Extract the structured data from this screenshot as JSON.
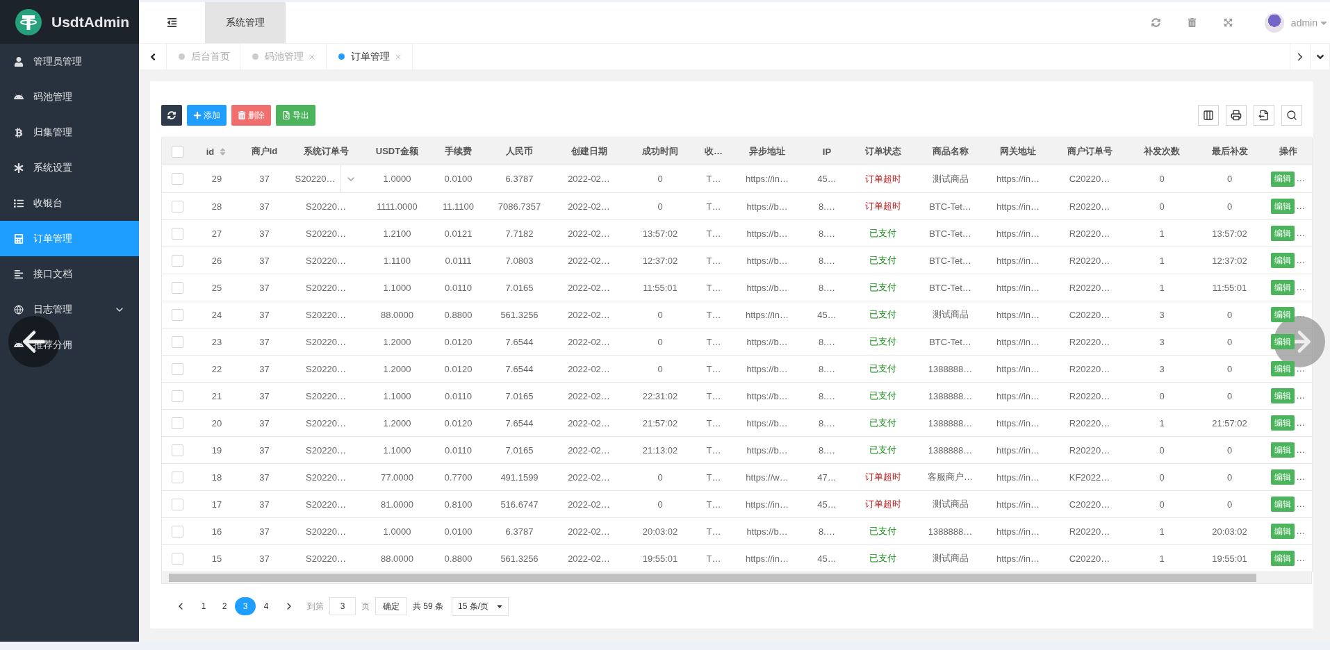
{
  "logo": {
    "title": "UsdtAdmin"
  },
  "sidebar": {
    "items": [
      {
        "label": "管理员管理",
        "selected": false,
        "expandable": false
      },
      {
        "label": "码池管理",
        "selected": false,
        "expandable": false
      },
      {
        "label": "归集管理",
        "selected": false,
        "expandable": false
      },
      {
        "label": "系统设置",
        "selected": false,
        "expandable": false
      },
      {
        "label": "收银台",
        "selected": false,
        "expandable": false
      },
      {
        "label": "订单管理",
        "selected": true,
        "expandable": false
      },
      {
        "label": "接口文档",
        "selected": false,
        "expandable": false
      },
      {
        "label": "日志管理",
        "selected": false,
        "expandable": true
      },
      {
        "label": "推荐分佣",
        "selected": false,
        "expandable": false
      }
    ]
  },
  "header": {
    "nav": [
      {
        "label": "系统管理",
        "selected": true
      }
    ],
    "user": "admin"
  },
  "page_tabs": [
    {
      "label": "后台首页",
      "selected": false,
      "closable": false
    },
    {
      "label": "码池管理",
      "selected": false,
      "closable": true
    },
    {
      "label": "订单管理",
      "selected": true,
      "closable": true
    }
  ],
  "toolbar": {
    "buttons": [
      {
        "kind": "refresh"
      },
      {
        "kind": "add",
        "label": "添加"
      },
      {
        "kind": "delete",
        "label": "删除"
      },
      {
        "kind": "export",
        "label": "导出"
      }
    ]
  },
  "table": {
    "header_checked": false,
    "columns": [
      {
        "label": "id",
        "sortable": true
      },
      {
        "label": "商户id",
        "sortable": false
      },
      {
        "label": "系统订单号",
        "sortable": false
      },
      {
        "label": "USDT金额",
        "sortable": false
      },
      {
        "label": "手续费",
        "sortable": false
      },
      {
        "label": "人民币",
        "sortable": false
      },
      {
        "label": "创建日期",
        "sortable": false
      },
      {
        "label": "成功时间",
        "sortable": false
      },
      {
        "label": "收…",
        "sortable": false
      },
      {
        "label": "异步地址",
        "sortable": false
      },
      {
        "label": "IP",
        "sortable": false
      },
      {
        "label": "订单状态",
        "sortable": false
      },
      {
        "label": "商品名称",
        "sortable": false
      },
      {
        "label": "网关地址",
        "sortable": false
      },
      {
        "label": "商户订单号",
        "sortable": false
      },
      {
        "label": "补发次数",
        "sortable": false
      },
      {
        "label": "最后补发",
        "sortable": false
      },
      {
        "label": "操作",
        "sortable": false
      }
    ],
    "rows": [
      {
        "checked": false,
        "tip_open": true,
        "cells": [
          "29",
          "37",
          "S20220…",
          "1.0000",
          "0.0100",
          "6.3787",
          "2022-02…",
          "0",
          "T…",
          "https://in…",
          "45…",
          {
            "text": "订单超时",
            "kind": "timeout"
          },
          "测试商品",
          "https://in…",
          "C20220…",
          "0",
          "0"
        ],
        "action": "编辑",
        "action_more": "…"
      },
      {
        "checked": false,
        "tip_open": false,
        "cells": [
          "28",
          "37",
          "S20220…",
          "1111.0000",
          "11.1100",
          "7086.7357",
          "2022-02…",
          "0",
          "T…",
          "https://b…",
          "8.…",
          {
            "text": "订单超时",
            "kind": "timeout"
          },
          "BTC-Tet…",
          "https://in…",
          "R20220…",
          "0",
          "0"
        ],
        "action": "编辑",
        "action_more": "…"
      },
      {
        "checked": false,
        "tip_open": false,
        "cells": [
          "27",
          "37",
          "S20220…",
          "1.2100",
          "0.0121",
          "7.7182",
          "2022-02…",
          "13:57:02",
          "T…",
          "https://b…",
          "8.…",
          {
            "text": "已支付",
            "kind": "paid"
          },
          "BTC-Tet…",
          "https://in…",
          "R20220…",
          "1",
          "13:57:02"
        ],
        "action": "编辑",
        "action_more": "…"
      },
      {
        "checked": false,
        "tip_open": false,
        "cells": [
          "26",
          "37",
          "S20220…",
          "1.1100",
          "0.0111",
          "7.0803",
          "2022-02…",
          "12:37:02",
          "T…",
          "https://b…",
          "8.…",
          {
            "text": "已支付",
            "kind": "paid"
          },
          "BTC-Tet…",
          "https://in…",
          "R20220…",
          "1",
          "12:37:02"
        ],
        "action": "编辑",
        "action_more": "…"
      },
      {
        "checked": false,
        "tip_open": false,
        "cells": [
          "25",
          "37",
          "S20220…",
          "1.1000",
          "0.0110",
          "7.0165",
          "2022-02…",
          "11:55:01",
          "T…",
          "https://b…",
          "8.…",
          {
            "text": "已支付",
            "kind": "paid"
          },
          "BTC-Tet…",
          "https://in…",
          "R20220…",
          "1",
          "11:55:01"
        ],
        "action": "编辑",
        "action_more": "…"
      },
      {
        "checked": false,
        "tip_open": false,
        "cells": [
          "24",
          "37",
          "S20220…",
          "88.0000",
          "0.8800",
          "561.3256",
          "2022-02…",
          "0",
          "T…",
          "https://in…",
          "45…",
          {
            "text": "已支付",
            "kind": "paid"
          },
          "测试商品",
          "https://in…",
          "C20220…",
          "3",
          "0"
        ],
        "action": "编辑",
        "action_more": "…"
      },
      {
        "checked": false,
        "tip_open": false,
        "cells": [
          "23",
          "37",
          "S20220…",
          "1.2000",
          "0.0120",
          "7.6544",
          "2022-02…",
          "0",
          "T…",
          "https://b…",
          "8.…",
          {
            "text": "已支付",
            "kind": "paid"
          },
          "BTC-Tet…",
          "https://in…",
          "R20220…",
          "3",
          "0"
        ],
        "action": "编辑",
        "action_more": "…"
      },
      {
        "checked": false,
        "tip_open": false,
        "cells": [
          "22",
          "37",
          "S20220…",
          "1.2000",
          "0.0120",
          "7.6544",
          "2022-02…",
          "0",
          "T…",
          "https://b…",
          "8.…",
          {
            "text": "已支付",
            "kind": "paid"
          },
          "1388888…",
          "https://in…",
          "R20220…",
          "3",
          "0"
        ],
        "action": "编辑",
        "action_more": "…"
      },
      {
        "checked": false,
        "tip_open": false,
        "cells": [
          "21",
          "37",
          "S20220…",
          "1.1000",
          "0.0110",
          "7.0165",
          "2022-02…",
          "22:31:02",
          "T…",
          "https://b…",
          "8.…",
          {
            "text": "已支付",
            "kind": "paid"
          },
          "1388888…",
          "https://in…",
          "R20220…",
          "0",
          "0"
        ],
        "action": "编辑",
        "action_more": "…"
      },
      {
        "checked": false,
        "tip_open": false,
        "cells": [
          "20",
          "37",
          "S20220…",
          "1.2000",
          "0.0120",
          "7.6544",
          "2022-02…",
          "21:57:02",
          "T…",
          "https://b…",
          "8.…",
          {
            "text": "已支付",
            "kind": "paid"
          },
          "1388888…",
          "https://in…",
          "R20220…",
          "1",
          "21:57:02"
        ],
        "action": "编辑",
        "action_more": "…"
      },
      {
        "checked": false,
        "tip_open": false,
        "cells": [
          "19",
          "37",
          "S20220…",
          "1.1000",
          "0.0110",
          "7.0165",
          "2022-02…",
          "21:13:02",
          "T…",
          "https://b…",
          "8.…",
          {
            "text": "已支付",
            "kind": "paid"
          },
          "1388888…",
          "https://in…",
          "R20220…",
          "0",
          "0"
        ],
        "action": "编辑",
        "action_more": "…"
      },
      {
        "checked": false,
        "tip_open": false,
        "cells": [
          "18",
          "37",
          "S20220…",
          "77.0000",
          "0.7700",
          "491.1599",
          "2022-02…",
          "0",
          "T…",
          "https://w…",
          "47…",
          {
            "text": "订单超时",
            "kind": "timeout"
          },
          "客服商户…",
          "https://in…",
          "KF2022…",
          "0",
          "0"
        ],
        "action": "编辑",
        "action_more": "…"
      },
      {
        "checked": false,
        "tip_open": false,
        "cells": [
          "17",
          "37",
          "S20220…",
          "81.0000",
          "0.8100",
          "516.6747",
          "2022-02…",
          "0",
          "T…",
          "https://in…",
          "45…",
          {
            "text": "订单超时",
            "kind": "timeout"
          },
          "测试商品",
          "https://in…",
          "C20220…",
          "0",
          "0"
        ],
        "action": "编辑",
        "action_more": "…"
      },
      {
        "checked": false,
        "tip_open": false,
        "cells": [
          "16",
          "37",
          "S20220…",
          "1.0000",
          "0.0100",
          "6.3787",
          "2022-02…",
          "20:03:02",
          "T…",
          "https://b…",
          "8.…",
          {
            "text": "已支付",
            "kind": "paid"
          },
          "1388888…",
          "https://in…",
          "R20220…",
          "1",
          "20:03:02"
        ],
        "action": "编辑",
        "action_more": "…"
      },
      {
        "checked": false,
        "tip_open": false,
        "cells": [
          "15",
          "37",
          "S20220…",
          "88.0000",
          "0.8800",
          "561.3256",
          "2022-02…",
          "19:55:01",
          "T…",
          "https://in…",
          "45…",
          {
            "text": "已支付",
            "kind": "paid"
          },
          "测试商品",
          "https://in…",
          "C20220…",
          "1",
          "19:55:01"
        ],
        "action": "编辑",
        "action_more": "…"
      }
    ]
  },
  "pagination": {
    "pages": [
      {
        "label": "1",
        "selected": false
      },
      {
        "label": "2",
        "selected": false
      },
      {
        "label": "3",
        "selected": true
      },
      {
        "label": "4",
        "selected": false
      }
    ],
    "goto_label": "到第",
    "goto_value": "3",
    "page_unit": "页",
    "confirm": "确定",
    "total": "共 59 条",
    "page_size": "15 条/页"
  }
}
